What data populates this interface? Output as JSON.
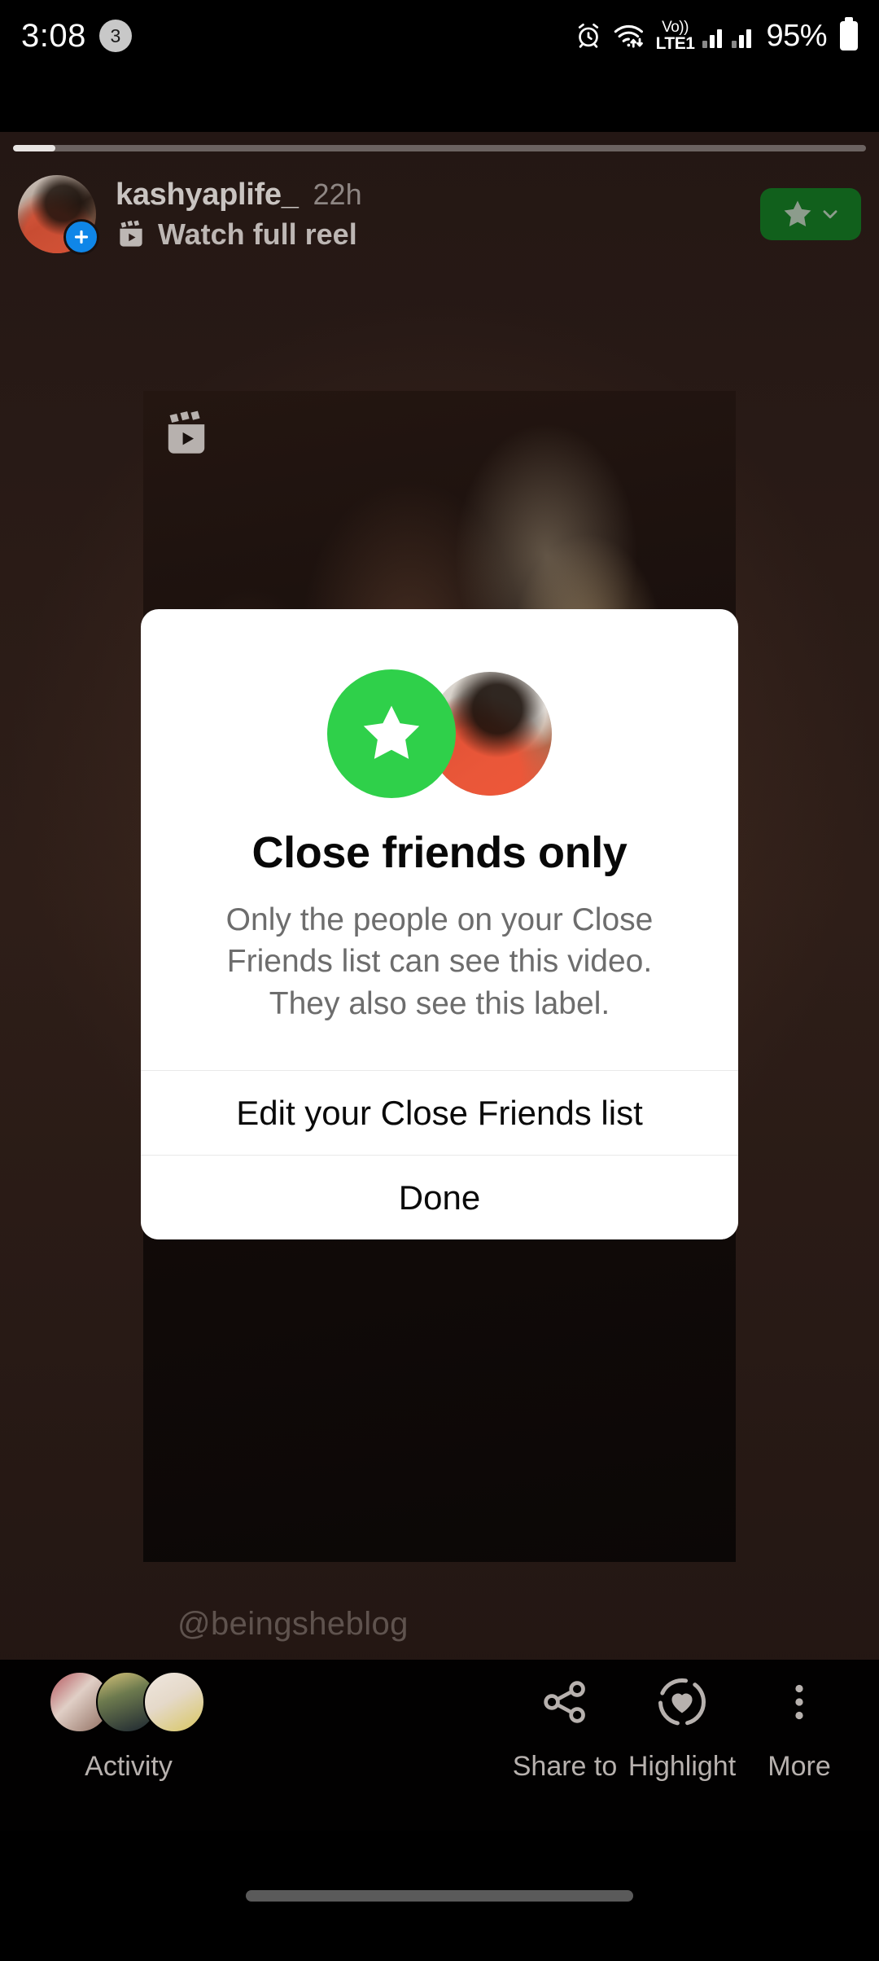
{
  "status_bar": {
    "time": "3:08",
    "notification_count": "3",
    "icons": [
      "alarm-icon",
      "wifi-icon",
      "volte-icon",
      "signal-sim1-icon",
      "signal-sim2-icon",
      "battery-icon"
    ],
    "volte_top": "Vo))",
    "volte_bottom": "LTE1",
    "battery_percent": "95%"
  },
  "story": {
    "progress_percent": 5,
    "username": "kashyaplife_",
    "timestamp": "22h",
    "watch_full_reel_label": "Watch full reel",
    "close_friends_badge": "close-friends-star-badge",
    "watermark": "@beingsheblog",
    "avatar_plus_badge": "add-to-story-plus-icon",
    "reel_icon": "reels-clapper-icon"
  },
  "bottom_bar": {
    "activity": {
      "label": "Activity",
      "avatar_count": 3
    },
    "actions": [
      {
        "label": "Share to",
        "icon": "share-icon"
      },
      {
        "label": "Highlight",
        "icon": "highlight-heart-icon"
      },
      {
        "label": "More",
        "icon": "more-vertical-icon"
      }
    ]
  },
  "dialog": {
    "icon_star": "close-friends-star-icon",
    "icon_avatar": "user-avatar",
    "title": "Close friends only",
    "body": "Only the people on your Close Friends list can see this video. They also see this label.",
    "buttons": [
      {
        "label": "Edit your Close Friends list",
        "name": "edit-close-friends-list-button"
      },
      {
        "label": "Done",
        "name": "done-button"
      }
    ]
  },
  "colors": {
    "close_friends_green": "#2fd04a",
    "badge_green": "#11601c",
    "accent_blue": "#0f86e8",
    "story_background": "#2a1b17",
    "dialog_background": "#ffffff"
  },
  "nav_bar": {
    "gesture_pill": "home-gesture-pill"
  }
}
